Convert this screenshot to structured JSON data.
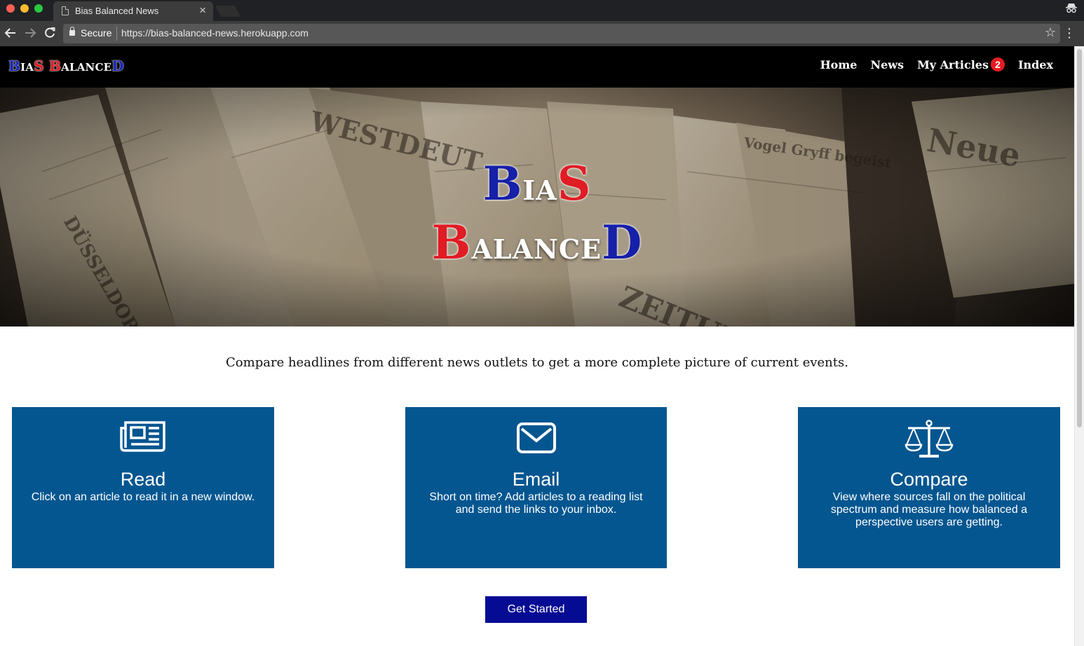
{
  "browser": {
    "tab_title": "Bias Balanced News",
    "tab_close": "×",
    "secure_label": "Secure",
    "url": "https://bias-balanced-news.herokuapp.com",
    "icons": [
      "back-arrow-icon",
      "forward-arrow-icon",
      "reload-icon",
      "lock-icon",
      "star-icon",
      "menu-icon",
      "incognito-icon"
    ]
  },
  "site": {
    "logo": {
      "w1_first": "B",
      "w1_mid": "IA",
      "w1_last": "S",
      "w2_first": "B",
      "w2_mid": "ALANCE",
      "w2_last": "D"
    },
    "nav": {
      "home": "Home",
      "news": "News",
      "my_articles": "My Articles",
      "my_articles_count": "2",
      "index": "Index"
    },
    "hero": {
      "w1_first": "B",
      "w1_mid": "IA",
      "w1_last": "S",
      "w2_first": "B",
      "w2_mid": "ALANCE",
      "w2_last": "D"
    },
    "tagline": "Compare headlines from different news outlets to get a more complete picture of current events.",
    "cards": [
      {
        "icon": "newspaper-icon",
        "title": "Read",
        "description": "Click on an article to read it in a new window."
      },
      {
        "icon": "envelope-icon",
        "title": "Email",
        "description": "Short on time? Add articles to a reading list and send the links to your inbox."
      },
      {
        "icon": "scale-icon",
        "title": "Compare",
        "description": "View where sources fall on the political spectrum and measure how balanced a perspective users are getting."
      }
    ],
    "cta": "Get Started"
  },
  "colors": {
    "card_blue": "#045690",
    "cta_blue": "#060b94",
    "logo_blue": "#1a25b8",
    "logo_red": "#e51b23",
    "nav_bg": "#000000"
  }
}
